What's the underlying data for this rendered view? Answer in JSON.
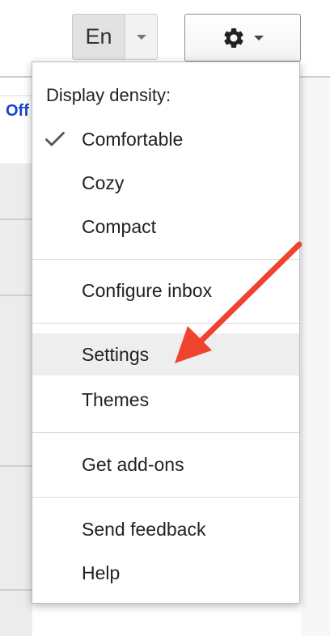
{
  "toolbar": {
    "language_label": "En",
    "language_dropdown_icon": "caret-down",
    "settings_icon": "gear",
    "settings_dropdown_icon": "caret-down"
  },
  "background": {
    "partial_link_text": "Off"
  },
  "settings_menu": {
    "density_heading": "Display density:",
    "density_options": [
      {
        "label": "Comfortable",
        "checked": true
      },
      {
        "label": "Cozy",
        "checked": false
      },
      {
        "label": "Compact",
        "checked": false
      }
    ],
    "configure_inbox": "Configure inbox",
    "settings": "Settings",
    "themes": "Themes",
    "get_addons": "Get add-ons",
    "send_feedback": "Send feedback",
    "help": "Help",
    "highlighted_item": "Settings"
  },
  "annotation": {
    "arrow_color": "#f0432f",
    "points_to": "Settings"
  },
  "colors": {
    "link_blue": "#1a44c8",
    "hover_gray": "#eeeeee"
  }
}
